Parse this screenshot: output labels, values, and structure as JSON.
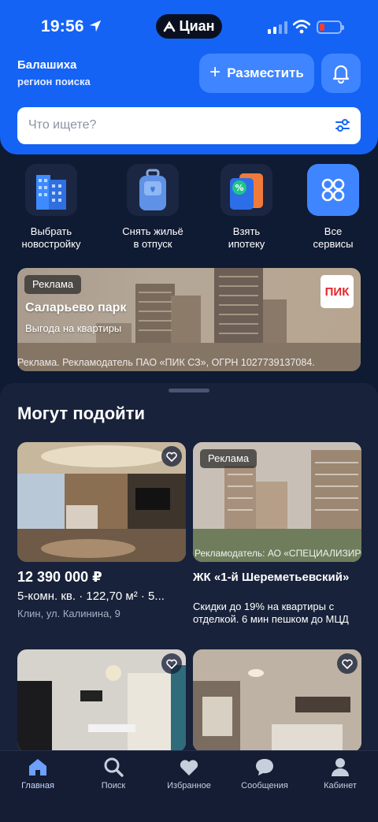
{
  "status": {
    "time": "19:56",
    "brand": "Циан"
  },
  "header": {
    "city": "Балашиха",
    "region_label": "регион поиска",
    "post_button": "Разместить"
  },
  "search": {
    "placeholder": "Что ищете?"
  },
  "services": [
    {
      "label": "Выбрать\nновостройку",
      "icon": "building-icon"
    },
    {
      "label": "Снять жильё\nв отпуск",
      "icon": "suitcase-icon"
    },
    {
      "label": "Взять\nипотеку",
      "icon": "mortgage-icon"
    },
    {
      "label": "Все\nсервисы",
      "icon": "grid-icon"
    }
  ],
  "banner": {
    "chip": "Реклама",
    "title": "Саларьево парк",
    "subtitle": "Выгода на квартиры",
    "logo": "ПИК",
    "footer": "Реклама. Рекламодатель ПАО «ПИК СЗ», ОГРН 1027739137084."
  },
  "feed": {
    "title": "Могут подойти",
    "listing1": {
      "price": "12 390 000 ₽",
      "params": "5-комн. кв. · 122,70 м² · 5...",
      "address": "Клин, ул. Калинина, 9"
    },
    "ad2": {
      "chip": "Реклама",
      "footer": "Рекламодатель: АО «СПЕЦИАЛИЗИРОВАННЫЙ",
      "title": "ЖК «1-й Шереметьевский»",
      "description": "Скидки до 19% на квартиры с отделкой. 6 мин пешком до МЦД"
    }
  },
  "tabbar": {
    "home": "Главная",
    "search": "Поиск",
    "favorites": "Избранное",
    "messages": "Сообщения",
    "profile": "Кабинет"
  },
  "colors": {
    "brand_blue": "#1463f5",
    "background": "#0f1a33",
    "sheet": "#18223a"
  }
}
